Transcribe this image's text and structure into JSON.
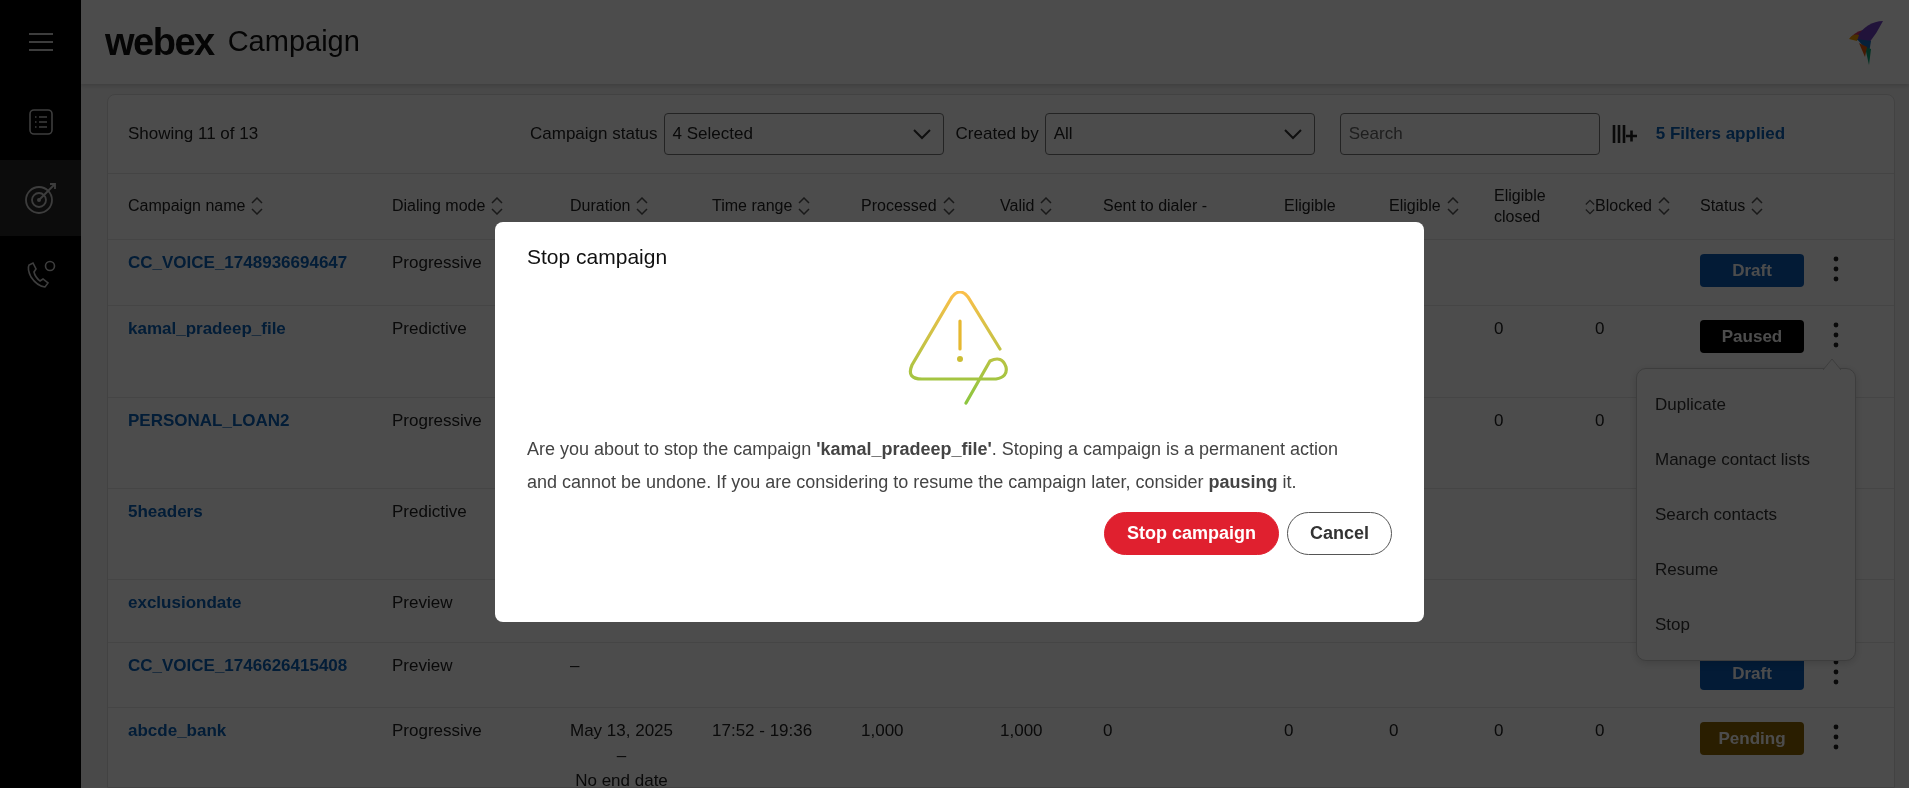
{
  "sidebar": {
    "items": [
      {
        "kind": "list",
        "selected": false
      },
      {
        "kind": "target",
        "selected": true
      },
      {
        "kind": "phone",
        "selected": false
      }
    ]
  },
  "header": {
    "logo": "webex",
    "title": "Campaign"
  },
  "toolbar": {
    "count": "Showing 11 of 13",
    "filters": [
      {
        "label": "Campaign status",
        "value": "4 Selected"
      },
      {
        "label": "Created by",
        "value": "All"
      }
    ],
    "search": {
      "placeholder": "Search"
    },
    "filters_applied": "5 Filters applied"
  },
  "table": {
    "columns": [
      {
        "label": "Campaign name",
        "sortable": true
      },
      {
        "label": "Dialing mode",
        "sortable": true
      },
      {
        "label": "Duration",
        "sortable": true
      },
      {
        "label": "Time range",
        "sortable": true
      },
      {
        "label": "Processed",
        "sortable": true
      },
      {
        "label": "Valid",
        "sortable": true
      },
      {
        "label": "Sent to dialer -",
        "sortable": false
      },
      {
        "label": "Eligible",
        "sortable": false
      },
      {
        "label": "Eligible",
        "sortable": true
      },
      {
        "label": "Eligible closed",
        "sortable": true
      },
      {
        "label": "Blocked",
        "sortable": true
      },
      {
        "label": "Status",
        "sortable": true
      }
    ],
    "rows": [
      {
        "cells": [
          "CC_VOICE_1748936694647",
          "Progressive"
        ],
        "status": {
          "label": "Draft",
          "kind": "draft"
        },
        "menu_open": false
      },
      {
        "cells": [
          "kamal_pradeep_file",
          "Predictive",
          "",
          "",
          "",
          "",
          "",
          "",
          "",
          "0",
          "0"
        ],
        "status": {
          "label": "Paused",
          "kind": "paused"
        },
        "menu_open": true
      },
      {
        "cells": [
          "PERSONAL_LOAN2",
          "Progressive",
          "",
          "",
          "",
          "",
          "",
          "",
          "",
          "0",
          "0"
        ]
      },
      {
        "cells": [
          "5headers",
          "Predictive"
        ]
      },
      {
        "cells": [
          "exclusiondate",
          "Preview"
        ]
      },
      {
        "cells": [
          "CC_VOICE_1746626415408",
          "Preview",
          [
            "–"
          ]
        ],
        "status": {
          "label": "Draft",
          "kind": "draft"
        },
        "menu_open": false
      },
      {
        "cells": [
          "abcde_bank",
          "Progressive",
          [
            "May 13, 2025",
            "–",
            "No end date"
          ],
          "17:52 - 19:36",
          "1,000",
          "1,000",
          "0",
          "0",
          "0",
          "0",
          "0"
        ],
        "status": {
          "label": "Pending",
          "kind": "pending"
        },
        "menu_open": false
      }
    ]
  },
  "row_menu": {
    "items": [
      "Duplicate",
      "Manage contact lists",
      "Search contacts",
      "Resume",
      "Stop"
    ]
  },
  "modal": {
    "title": "Stop campaign",
    "message": "Are you about to stop the campaign **'kamal_pradeep_file'**. Stoping a campaign is a permanent action and cannot be undone. If you are considering to resume the campaign later, consider **pausing** it.",
    "buttons": [
      {
        "label": "Stop campaign",
        "kind": "danger"
      },
      {
        "label": "Cancel",
        "kind": "secondary"
      }
    ]
  }
}
